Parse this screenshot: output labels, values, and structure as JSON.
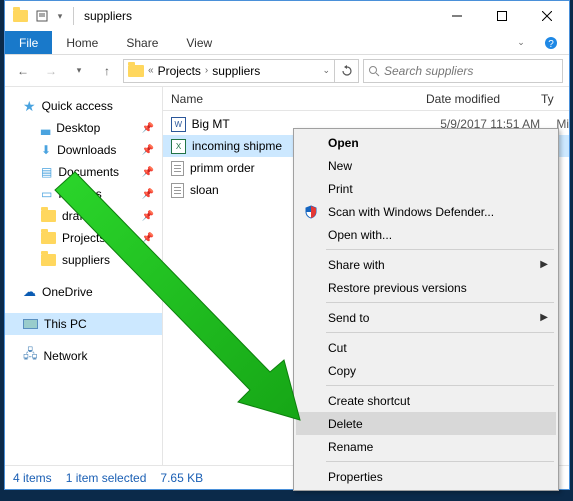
{
  "titlebar": {
    "title": "suppliers"
  },
  "ribbon": {
    "file": "File",
    "tabs": [
      "Home",
      "Share",
      "View"
    ]
  },
  "breadcrumb": {
    "prefix": "«",
    "items": [
      "Projects",
      "suppliers"
    ]
  },
  "search": {
    "placeholder": "Search suppliers"
  },
  "nav": {
    "quick_access": "Quick access",
    "items": [
      "Desktop",
      "Downloads",
      "Documents",
      "Pictures",
      "drafts",
      "Projects",
      "suppliers"
    ],
    "onedrive": "OneDrive",
    "thispc": "This PC",
    "network": "Network"
  },
  "columns": {
    "name": "Name",
    "date": "Date modified",
    "type": "Ty"
  },
  "files": [
    {
      "name": "Big MT",
      "date": "5/9/2017 11:51 AM",
      "type": "Mi",
      "kind": "word"
    },
    {
      "name": "incoming shipme",
      "date": "",
      "type": "",
      "kind": "excel",
      "selected": true
    },
    {
      "name": "primm order",
      "date": "",
      "type": "",
      "kind": "txt"
    },
    {
      "name": "sloan",
      "date": "",
      "type": "",
      "kind": "txt"
    }
  ],
  "status": {
    "count": "4 items",
    "selected": "1 item selected",
    "size": "7.65 KB"
  },
  "context_menu": {
    "open": "Open",
    "new": "New",
    "print": "Print",
    "defender": "Scan with Windows Defender...",
    "openwith": "Open with...",
    "sharewith": "Share with",
    "restore": "Restore previous versions",
    "sendto": "Send to",
    "cut": "Cut",
    "copy": "Copy",
    "shortcut": "Create shortcut",
    "delete": "Delete",
    "rename": "Rename",
    "properties": "Properties"
  }
}
